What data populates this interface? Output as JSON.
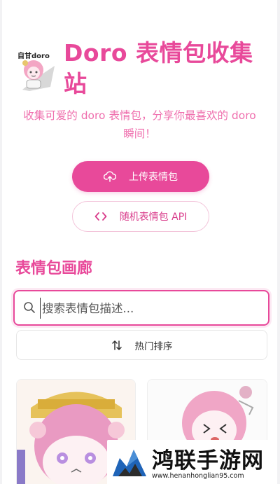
{
  "header": {
    "logo_text": "自甘doro",
    "title": "Doro 表情包收集站",
    "subtitle": "收集可爱的 doro 表情包，分享你最喜欢的 doro 瞬间！"
  },
  "actions": {
    "upload_label": "上传表情包",
    "random_label": "随机表情包 API"
  },
  "gallery": {
    "title": "表情包画廊",
    "search_placeholder": "搜索表情包描述...",
    "search_value": "",
    "sort_label": "热门排序"
  },
  "watermark": {
    "title": "鸿联手游网",
    "url": "www.henanhonglian95.com"
  },
  "colors": {
    "accent": "#e8499a",
    "accent_light": "#ef6fae",
    "border_soft": "#f3c4da"
  },
  "icons": {
    "upload": "cloud-upload-icon",
    "random": "code-icon",
    "search": "search-icon",
    "sort": "sort-arrows-icon"
  }
}
